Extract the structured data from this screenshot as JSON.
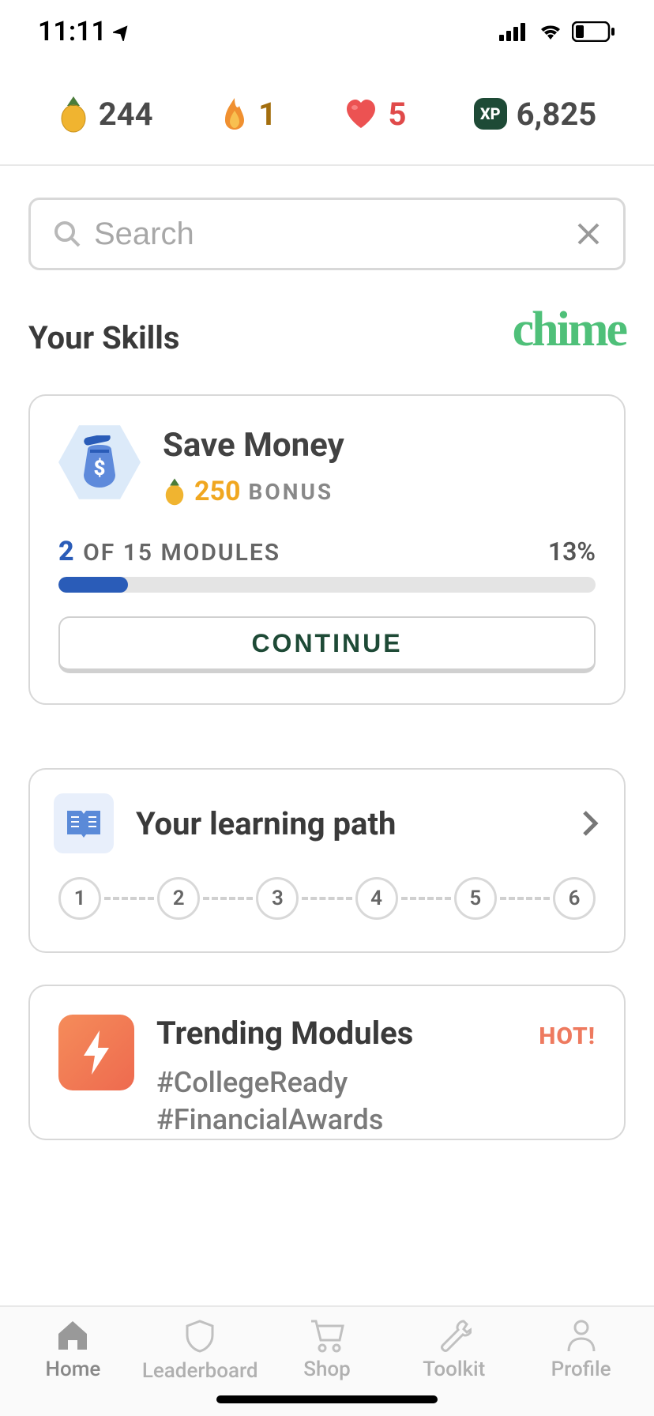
{
  "status": {
    "time": "11:11"
  },
  "stats": {
    "pineapple": "244",
    "fire": "1",
    "heart": "5",
    "xp_label": "XP",
    "xp": "6,825"
  },
  "search": {
    "placeholder": "Search"
  },
  "skills": {
    "section_title": "Your Skills",
    "sponsor": "chime",
    "card": {
      "title": "Save Money",
      "bonus_value": "250",
      "bonus_label": "BONUS",
      "completed": "2",
      "of_text": "OF 15 MODULES",
      "percent": "13%",
      "progress_width": "13%",
      "continue": "CONTINUE"
    }
  },
  "path": {
    "title": "Your learning path",
    "steps": [
      "1",
      "2",
      "3",
      "4",
      "5",
      "6"
    ]
  },
  "trending": {
    "title": "Trending Modules",
    "badge": "HOT!",
    "tags": [
      "#CollegeReady",
      "#FinancialAwards"
    ]
  },
  "tabs": {
    "home": "Home",
    "leaderboard": "Leaderboard",
    "shop": "Shop",
    "toolkit": "Toolkit",
    "profile": "Profile"
  }
}
